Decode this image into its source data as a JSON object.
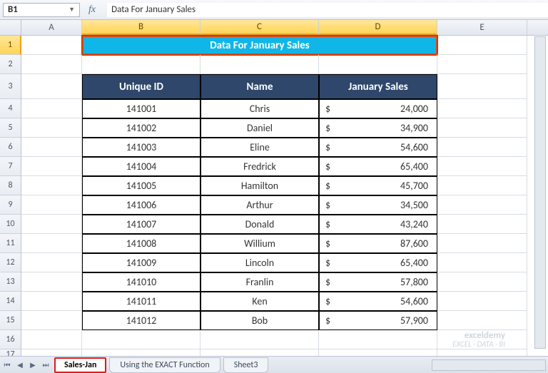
{
  "namebox": "B1",
  "formula_value": "Data For January Sales",
  "columns": [
    "A",
    "B",
    "C",
    "D",
    "E"
  ],
  "selected_cols": [
    "B",
    "C",
    "D"
  ],
  "row_labels": [
    1,
    2,
    3,
    4,
    5,
    6,
    7,
    8,
    9,
    10,
    11,
    12,
    13,
    14,
    15,
    16,
    17
  ],
  "selected_row": 1,
  "title": "Data For January Sales",
  "headers": {
    "id": "Unique ID",
    "name": "Name",
    "sales": "January Sales"
  },
  "currency": "$",
  "rows": [
    {
      "id": "141001",
      "name": "Chris",
      "sales": "24,000"
    },
    {
      "id": "141002",
      "name": "Daniel",
      "sales": "34,900"
    },
    {
      "id": "141003",
      "name": "Eline",
      "sales": "54,600"
    },
    {
      "id": "141004",
      "name": "Fredrick",
      "sales": "65,400"
    },
    {
      "id": "141005",
      "name": "Hamilton",
      "sales": "45,700"
    },
    {
      "id": "141006",
      "name": "Arthur",
      "sales": "34,500"
    },
    {
      "id": "141007",
      "name": "Donald",
      "sales": "43,240"
    },
    {
      "id": "141008",
      "name": "Willium",
      "sales": "87,600"
    },
    {
      "id": "141009",
      "name": "Lincoln",
      "sales": "65,400"
    },
    {
      "id": "141010",
      "name": "Franlin",
      "sales": "57,800"
    },
    {
      "id": "141011",
      "name": "Ken",
      "sales": "54,600"
    },
    {
      "id": "141012",
      "name": "Bob",
      "sales": "57,900"
    }
  ],
  "watermark": {
    "top": "exceldemy",
    "bot": "EXCEL · DATA · BI"
  },
  "tabs": [
    {
      "label": "Sales-Jan",
      "active": true
    },
    {
      "label": "Using the EXACT Function",
      "active": false
    },
    {
      "label": "Sheet3",
      "active": false
    }
  ]
}
